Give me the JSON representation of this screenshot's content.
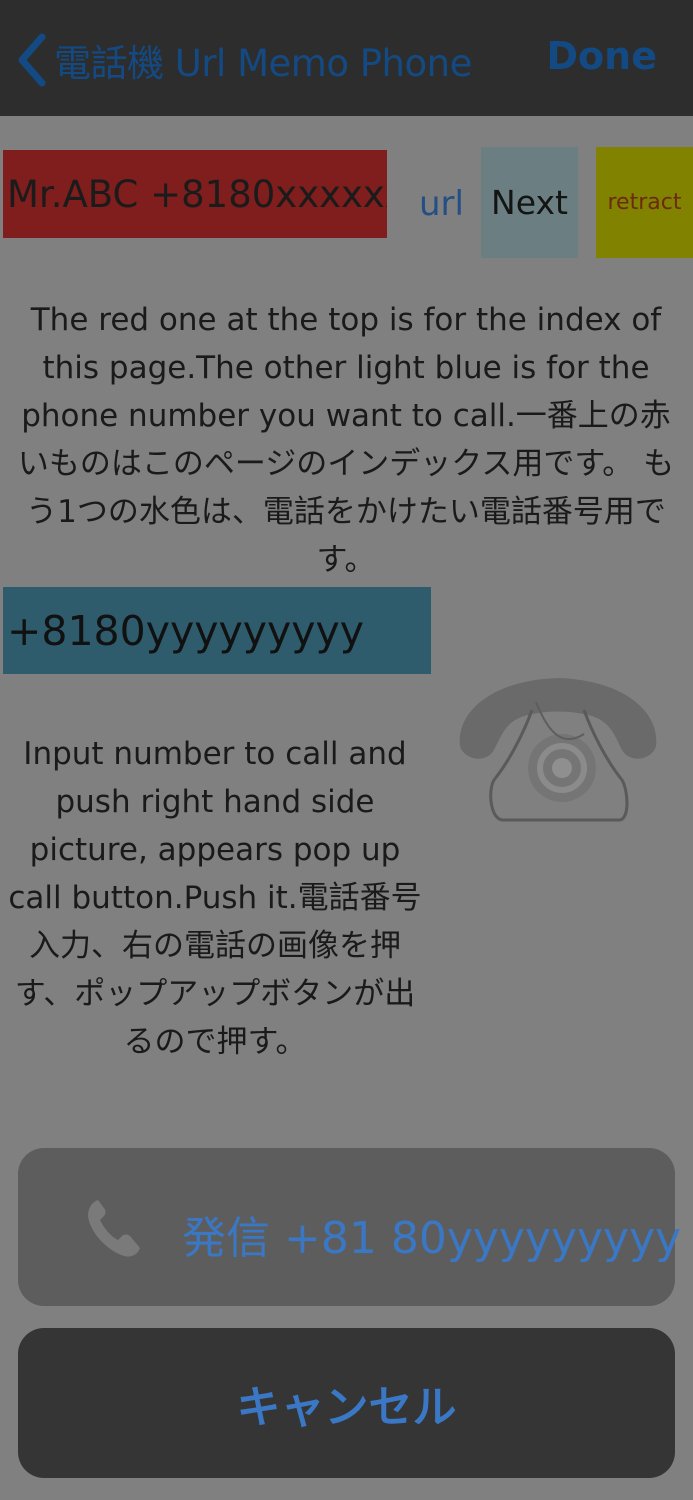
{
  "nav": {
    "back_title": "電話機 Url Memo Phone",
    "done_label": "Done"
  },
  "top_row": {
    "index_value": "Mr.ABC +8180xxxxxx...",
    "url_label": "url",
    "next_label": "Next",
    "retract_label": "retract"
  },
  "description_1": "The red one at the top is for the index of this page.The other light blue is for the phone number you want to call.一番上の赤いものはこのページのインデックス用です。 もう1つの水色は、電話をかけたい電話番号用です。",
  "phone_number_value": "+8180yyyyyyyyy",
  "description_2": "Input  number to call and push right hand side picture, appears pop up call button.Push it.電話番号入力、右の電話の画像を押す、ポップアップボタンが出るので押す。",
  "action_sheet": {
    "call_label": "発信 +81 80yyyyyyyyy",
    "cancel_label": "キャンセル"
  },
  "colors": {
    "accent": "#3a78c6",
    "index_bg": "#7f1e1c",
    "phone_bg": "#2e5c6d",
    "next_bg": "#6b7f82",
    "retract_bg": "#818200"
  },
  "icons": {
    "back": "chevron-left-icon",
    "phone_picture": "rotary-telephone-icon",
    "call": "phone-handset-icon"
  }
}
